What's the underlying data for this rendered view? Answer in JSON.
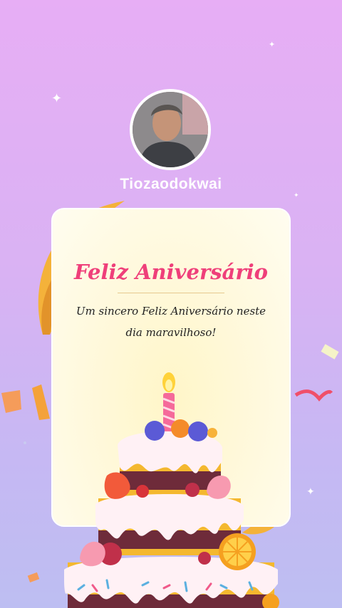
{
  "profile": {
    "username": "Tiozaodokwai",
    "avatar_icon": "user-photo"
  },
  "card": {
    "title": "Feliz Aniversário",
    "message": "Um sincero Feliz Aniversário neste dia maravilhoso!"
  },
  "colors": {
    "title": "#ef3f7a",
    "background_top": "#e7aef5",
    "background_bottom": "#bdbef2"
  }
}
